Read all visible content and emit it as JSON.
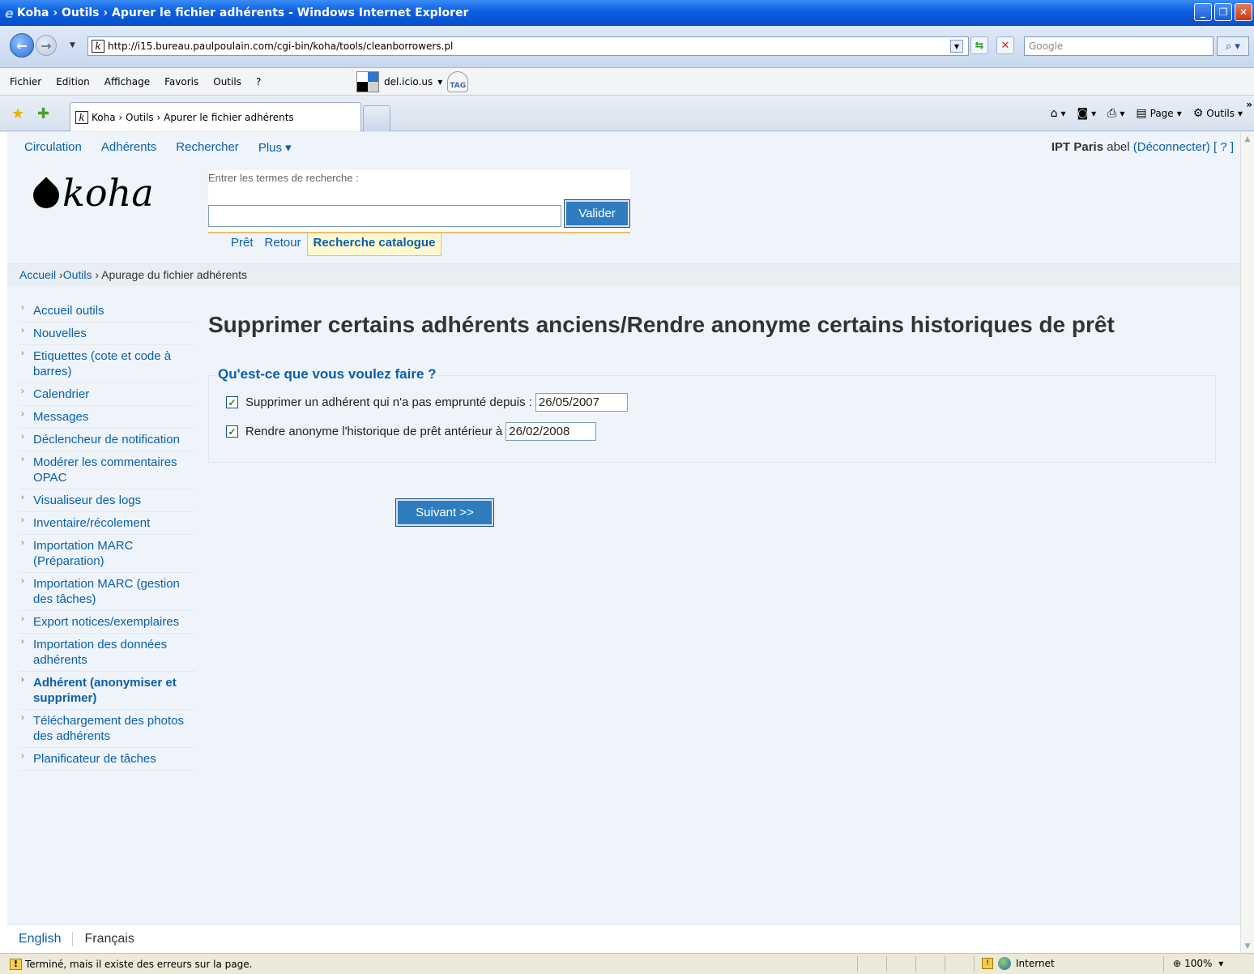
{
  "window": {
    "title": "Koha › Outils › Apurer le fichier adhérents - Windows Internet Explorer"
  },
  "browser": {
    "url": "http://i15.bureau.paulpoulain.com/cgi-bin/koha/tools/cleanborrowers.pl",
    "search_placeholder": "Google",
    "menu": [
      "Fichier",
      "Edition",
      "Affichage",
      "Favoris",
      "Outils",
      "?"
    ],
    "delicious_label": "del.icio.us",
    "tag_label": "TAG",
    "tab_title": "Koha › Outils › Apurer le fichier adhérents",
    "cmd_page": "Page",
    "cmd_tools": "Outils",
    "favicon_letter": "k"
  },
  "koha": {
    "topnav": [
      "Circulation",
      "Adhérents",
      "Rechercher",
      "Plus ▾"
    ],
    "library": "IPT Paris",
    "user": "abel",
    "logout": "(Déconnecter)",
    "help": "[ ? ]",
    "logo_text": "koha",
    "search_label": "Entrer les termes de recherche :",
    "search_button": "Valider",
    "search_tabs": [
      "Prêt",
      "Retour",
      "Recherche catalogue"
    ],
    "breadcrumb": {
      "home": "Accueil",
      "sep1": " ›",
      "tools": "Outils",
      "sep2": " › ",
      "current": "Apurage du fichier adhérents"
    },
    "sidebar": [
      "Accueil outils",
      "Nouvelles",
      "Etiquettes (cote et code à barres)",
      "Calendrier",
      "Messages",
      "Déclencheur de notification",
      "Modérer les commentaires OPAC",
      "Visualiseur des logs",
      "Inventaire/récolement",
      "Importation MARC (Préparation)",
      "Importation MARC (gestion des tâches)",
      "Export notices/exemplaires",
      "Importation des données adhérents",
      "Adhérent (anonymiser et supprimer)",
      "Téléchargement des photos des adhérents",
      "Planificateur de tâches"
    ],
    "sidebar_current_index": 13,
    "page_title": "Supprimer certains adhérents anciens/Rendre anonyme certains historiques de prêt",
    "legend": "Qu'est-ce que vous voulez faire ?",
    "option1": {
      "label": "Supprimer un adhérent qui n'a pas emprunté depuis :",
      "checked": true,
      "date": "26/05/2007"
    },
    "option2": {
      "label": "Rendre anonyme l'historique de prêt antérieur à",
      "checked": true,
      "date": "26/02/2008"
    },
    "next_button": "Suivant >>",
    "languages": [
      "English",
      "Français"
    ]
  },
  "status": {
    "text": "Terminé, mais il existe des erreurs sur la page.",
    "zone": "Internet",
    "zoom": "100%"
  },
  "colors": {
    "link": "#0a5fa8",
    "button": "#2f7dc0",
    "page_bg": "#eef4fa",
    "title_bar": "#0b5ee0"
  }
}
